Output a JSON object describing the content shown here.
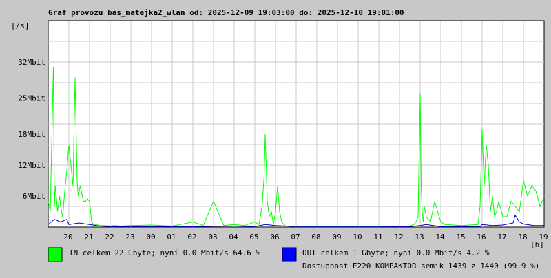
{
  "chart_data": {
    "type": "line",
    "title": "Graf provozu bas_matejka2_wlan od: 2025-12-09 19:03:00 do: 2025-12-10 19:01:00",
    "ylabel": "[/s]",
    "xlabel": "[h]",
    "ylim": [
      0,
      40
    ],
    "y_unit": "Mbit/s",
    "x_range_hours": [
      0,
      24
    ],
    "y_tick_values": [
      6,
      12,
      18,
      25,
      32
    ],
    "y_tick_labels": [
      "6Mbit",
      "12Mbit",
      "18Mbit",
      "25Mbit",
      "32Mbit"
    ],
    "x_tick_labels": [
      "20",
      "21",
      "22",
      "23",
      "00",
      "01",
      "02",
      "03",
      "04",
      "05",
      "06",
      "07",
      "08",
      "09",
      "10",
      "11",
      "12",
      "13",
      "14",
      "15",
      "16",
      "17",
      "18",
      "19"
    ],
    "grid": true,
    "series": [
      {
        "name": "IN",
        "color": "#00ff00",
        "x": [
          0,
          0.1,
          0.25,
          0.3,
          0.35,
          0.45,
          0.55,
          0.6,
          0.7,
          0.8,
          0.9,
          1.0,
          1.1,
          1.2,
          1.3,
          1.4,
          1.45,
          1.55,
          1.6,
          1.7,
          1.8,
          1.9,
          2.0,
          2.1,
          2.2,
          2.4,
          2.5,
          2.7,
          3.0,
          3.2,
          3.5,
          4.0,
          5.0,
          6.0,
          7.0,
          7.5,
          8.0,
          8.5,
          9.0,
          9.5,
          10.0,
          10.2,
          10.35,
          10.45,
          10.5,
          10.55,
          10.6,
          10.7,
          10.8,
          10.9,
          11.0,
          11.1,
          11.2,
          11.3,
          11.4,
          11.5,
          12.0,
          14.0,
          16.0,
          17.5,
          17.7,
          17.8,
          17.9,
          18.0,
          18.05,
          18.1,
          18.15,
          18.2,
          18.3,
          18.5,
          18.7,
          19.0,
          19.2,
          20.0,
          20.8,
          20.9,
          21.0,
          21.1,
          21.2,
          21.3,
          21.4,
          21.5,
          21.6,
          21.7,
          21.8,
          22.0,
          22.2,
          22.4,
          22.6,
          22.8,
          23.0,
          23.2,
          23.4,
          23.6,
          23.8,
          24.0
        ],
        "y": [
          5,
          3,
          31,
          4,
          8,
          3,
          6,
          4,
          2,
          7,
          11,
          16,
          12,
          8,
          29,
          9,
          6,
          8,
          7,
          5,
          5,
          5.5,
          5,
          1,
          0.5,
          0.5,
          0.3,
          0.3,
          0.2,
          0.3,
          0.2,
          0.3,
          0.4,
          0.2,
          1,
          0.3,
          5,
          0.3,
          0.5,
          0.3,
          1,
          0.5,
          4,
          10,
          18,
          12,
          5,
          2,
          3,
          0.5,
          3,
          8,
          3,
          1,
          0.5,
          0.2,
          0.1,
          0.1,
          0.1,
          0.2,
          0.5,
          1,
          2,
          26,
          8,
          3,
          1,
          4,
          2,
          1,
          5,
          1,
          0.5,
          0.3,
          0.5,
          4,
          19,
          8,
          16,
          12,
          3,
          6,
          2,
          3,
          5,
          2,
          2,
          5,
          4,
          3,
          9,
          6,
          8,
          7,
          4,
          6
        ]
      },
      {
        "name": "OUT",
        "color": "#0000cc",
        "x": [
          0,
          0.3,
          0.6,
          0.9,
          1.0,
          1.5,
          2.0,
          2.5,
          3,
          5,
          7,
          9,
          10,
          10.5,
          11,
          12,
          14,
          16,
          17.5,
          18,
          18.3,
          19,
          20,
          20.9,
          21,
          21.5,
          22,
          22.5,
          22.6,
          22.8,
          23,
          23.5,
          24
        ],
        "y": [
          0.5,
          1.5,
          1,
          1.5,
          0.5,
          0.8,
          0.5,
          0.2,
          0.1,
          0.1,
          0.1,
          0.2,
          0.1,
          0.5,
          0.3,
          0.1,
          0.1,
          0.1,
          0.1,
          0.3,
          0.5,
          0.1,
          0.1,
          0.1,
          0.5,
          0.3,
          0.4,
          0.8,
          2.3,
          1,
          0.6,
          0.3,
          0.3
        ]
      }
    ]
  },
  "legend": {
    "in_color": "#00ff00",
    "out_color": "#0000ff",
    "in_text": "IN celkem 22 Gbyte; nyní   0.0 Mbit/s 64.6 %",
    "out_text": "OUT celkem 1 Gbyte; nyní   0.0 Mbit/s 4.2 %",
    "availability_text": "Dostupnost E220 KOMPAKTOR semik 1439 z 1440 (99.9 %)",
    "availability_color": "#ff0000"
  }
}
